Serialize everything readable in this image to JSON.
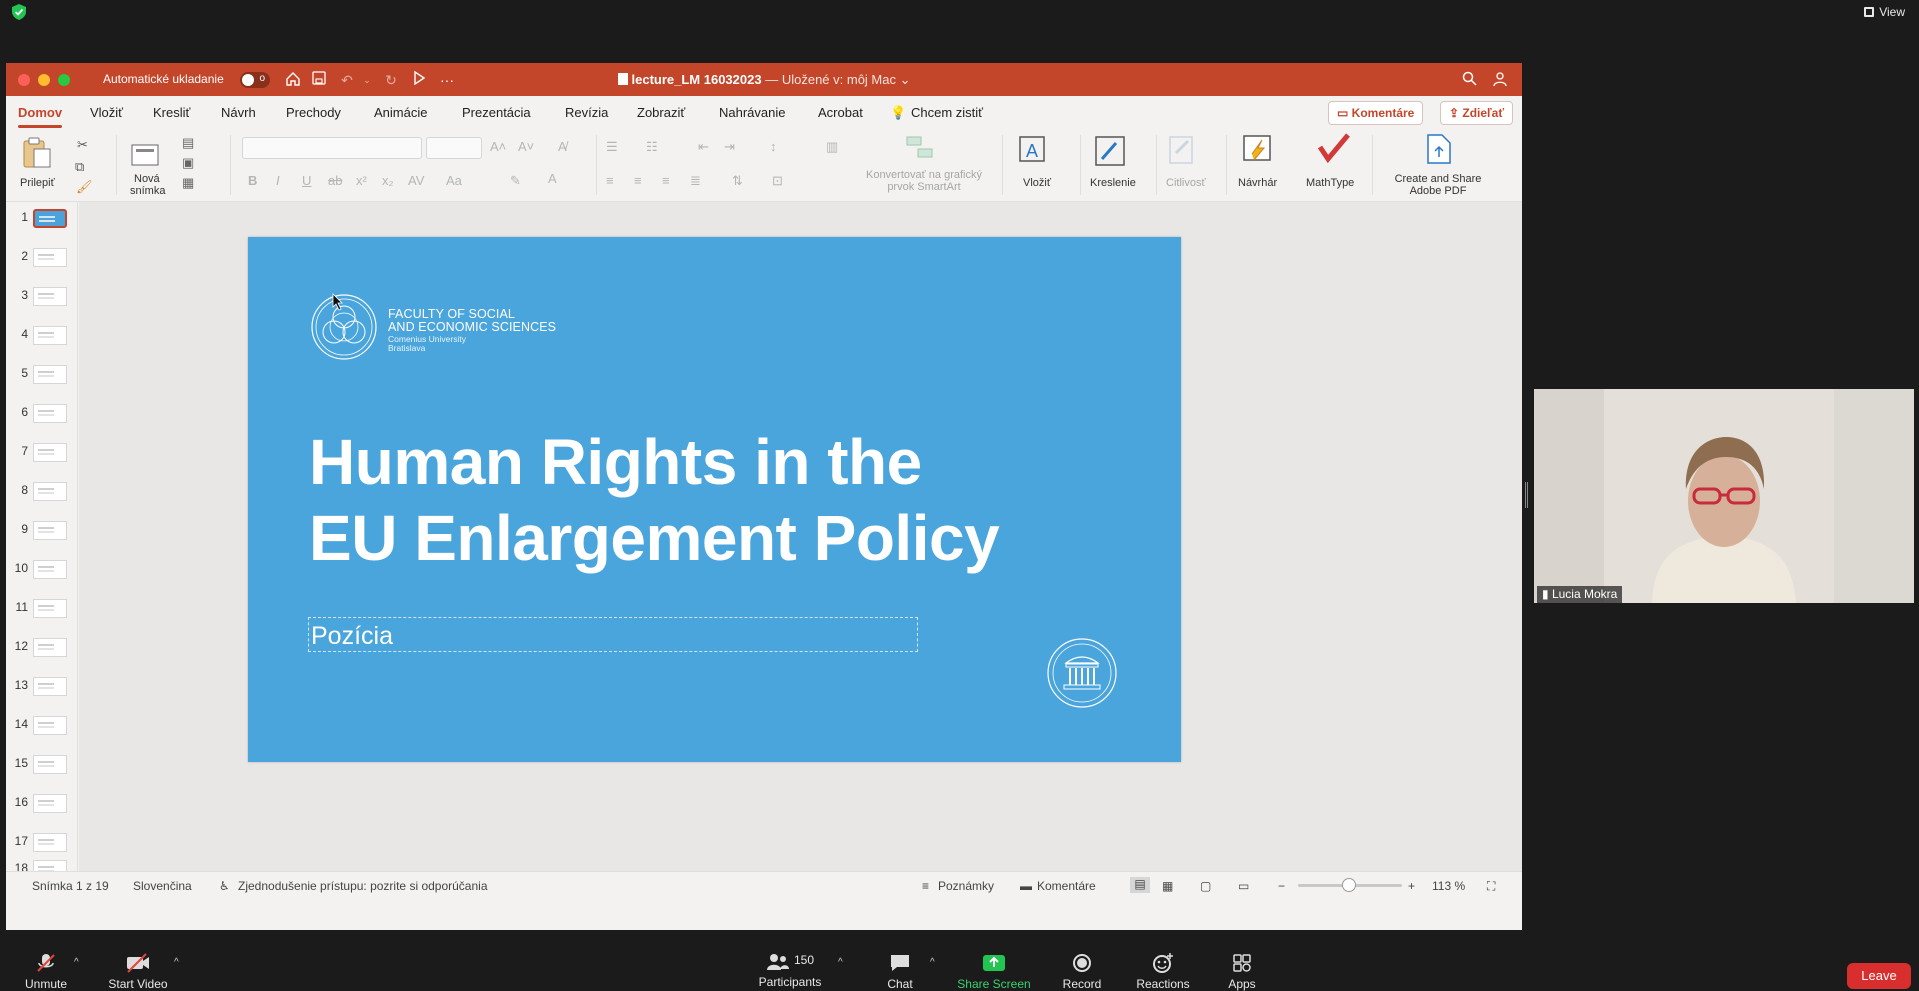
{
  "zoom": {
    "view_label": "View",
    "participants_count": "150",
    "participant_name": "Lucia Mokra",
    "controls": {
      "unmute": "Unmute",
      "start_video": "Start Video",
      "participants": "Participants",
      "chat": "Chat",
      "share_screen": "Share Screen",
      "record": "Record",
      "reactions": "Reactions",
      "apps": "Apps",
      "leave": "Leave"
    }
  },
  "ppt": {
    "autosave_label": "Automatické ukladanie",
    "autosave_state": "o",
    "doc_title": "lecture_LM 16032023",
    "doc_subtitle": "— Uložené v: môj Mac",
    "tabs": [
      "Domov",
      "Vložiť",
      "Kresliť",
      "Návrh",
      "Prechody",
      "Animácie",
      "Prezentácia",
      "Revízia",
      "Zobraziť",
      "Nahrávanie",
      "Acrobat"
    ],
    "tell_me": "Chcem zistiť",
    "comments_btn": "Komentáre",
    "share_btn": "Zdieľať",
    "ribbon": {
      "paste": "Prilepiť",
      "new_slide_1": "Nová",
      "new_slide_2": "snímka",
      "smartart_1": "Konvertovať na grafický",
      "smartart_2": "prvok SmartArt",
      "insert": "Vložiť",
      "drawing": "Kreslenie",
      "sensitivity": "Citlivosť",
      "designer": "Návrhár",
      "mathtype": "MathType",
      "adobe_1": "Create and Share",
      "adobe_2": "Adobe PDF"
    },
    "thumbnails": [
      "1",
      "2",
      "3",
      "4",
      "5",
      "6",
      "7",
      "8",
      "9",
      "10",
      "11",
      "12",
      "13",
      "14",
      "15",
      "16",
      "17",
      "18"
    ],
    "slide": {
      "faculty_1": "FACULTY OF SOCIAL",
      "faculty_2": "AND ECONOMIC SCIENCES",
      "university": "Comenius University",
      "city": "Bratislava",
      "title_line1": "Human Rights in the",
      "title_line2": "EU Enlargement Policy",
      "subtitle": "Pozícia"
    },
    "status": {
      "slide_info": "Snímka 1 z 19",
      "language": "Slovenčina",
      "accessibility": "Zjednodušenie prístupu: pozrite si odporúčania",
      "notes": "Poznámky",
      "comments": "Komentáre",
      "zoom": "113 %"
    }
  },
  "colors": {
    "titlebar": "#c4462a",
    "slide_bg": "#4aa5dd",
    "leave": "#d92e2e"
  }
}
